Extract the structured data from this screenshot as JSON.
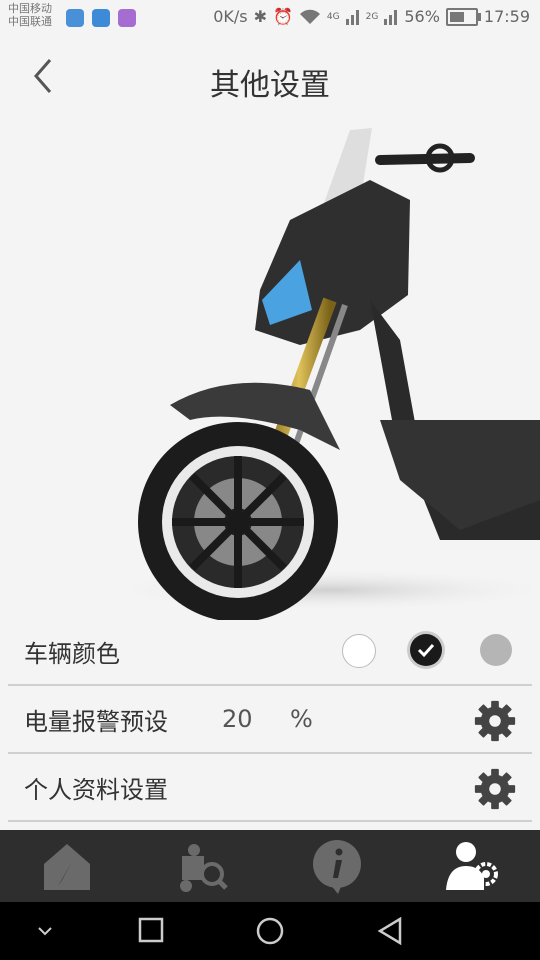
{
  "status_bar": {
    "carrier_1": "中国移动",
    "carrier_2": "中国联通",
    "speed": "0K/s",
    "network_4g": "4G",
    "network_2g": "2G",
    "battery": "56%",
    "time": "17:59"
  },
  "header": {
    "title": "其他设置",
    "back_icon": "chevron-left-icon"
  },
  "settings": {
    "vehicle_color": {
      "label": "车辆颜色",
      "options": [
        "white",
        "black",
        "gray"
      ],
      "selected": "black"
    },
    "battery_alarm": {
      "label": "电量报警预设",
      "value": "20",
      "unit": "%"
    },
    "profile": {
      "label": "个人资料设置"
    }
  },
  "colors": {
    "swatch_white": "#ffffff",
    "swatch_black": "#1a1a1a",
    "swatch_gray": "#b5b5b5",
    "gear": "#444444",
    "tabbar": "#2e2e2e"
  },
  "tabs": [
    "home-icon",
    "scooter-search-icon",
    "info-icon",
    "user-settings-icon"
  ],
  "tab_selected": "user-settings-icon"
}
